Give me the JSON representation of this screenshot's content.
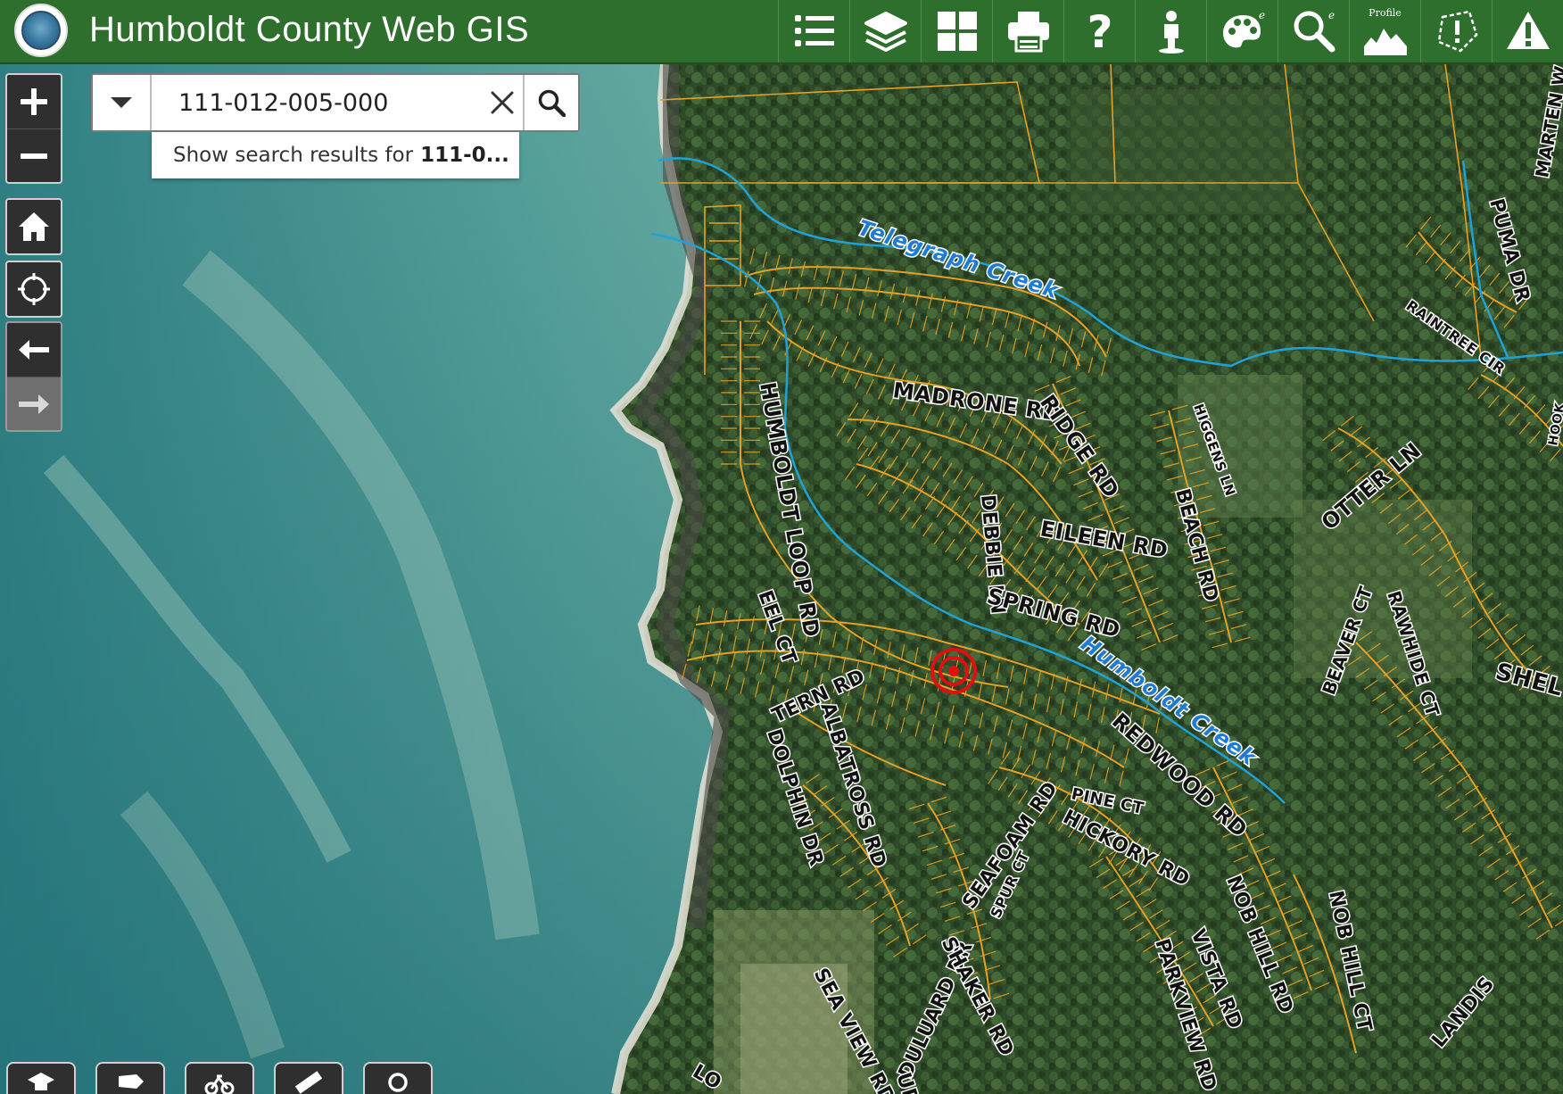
{
  "header": {
    "title": "Humboldt County Web GIS",
    "toolbar": [
      {
        "name": "legend-icon",
        "label": ""
      },
      {
        "name": "layers-icon",
        "label": ""
      },
      {
        "name": "basemap-gallery-icon",
        "label": ""
      },
      {
        "name": "print-icon",
        "label": ""
      },
      {
        "name": "help-icon",
        "label": ""
      },
      {
        "name": "identify-icon",
        "label": ""
      },
      {
        "name": "draw-icon",
        "label": ""
      },
      {
        "name": "enhanced-search-icon",
        "label": ""
      },
      {
        "name": "elevation-profile-icon",
        "label": "Profile"
      },
      {
        "name": "report-icon",
        "label": ""
      },
      {
        "name": "alert-icon",
        "label": ""
      }
    ]
  },
  "search": {
    "value": "111-012-005-000",
    "suggestion_prefix": "Show search results for",
    "suggestion_term": "111-0..."
  },
  "map": {
    "marker": "target-marker",
    "creeks": [
      "Telegraph Creek",
      "Humboldt Creek"
    ],
    "roads": [
      "MADRONE RD",
      "RIDGE RD",
      "DEBBIE LN",
      "EILEEN RD",
      "BEACH RD",
      "SPRING RD",
      "HUMBOLDT LOOP RD",
      "EEL CT",
      "TERN RD",
      "ALBATROSS RD",
      "DOLPHIN DR",
      "REDWOOD RD",
      "PINE CT",
      "HICKORY RD",
      "SEAFOAM RD",
      "SPUR CT",
      "DULUARD DR",
      "SHAKER RD",
      "SEA VIEW RD",
      "UPPER",
      "PARKVIEW RD",
      "VISTA RD",
      "NOB HILL RD",
      "NOB HILL CT",
      "BEAVER CT",
      "RAWHIDE CT",
      "OTTER LN",
      "HIGGENS LN",
      "RAINTREE CIR",
      "PUMA DR",
      "MARTEN W",
      "SHEL",
      "LANDIS",
      "LO",
      "HOOK"
    ]
  },
  "colors": {
    "header_bg": "#2f6f2d",
    "parcel_line": "#e6a024",
    "creek_line": "#1fa2d8",
    "creek_label": "#1e7bd6",
    "marker": "#e01010",
    "control_bg": "#2f2f2f"
  }
}
